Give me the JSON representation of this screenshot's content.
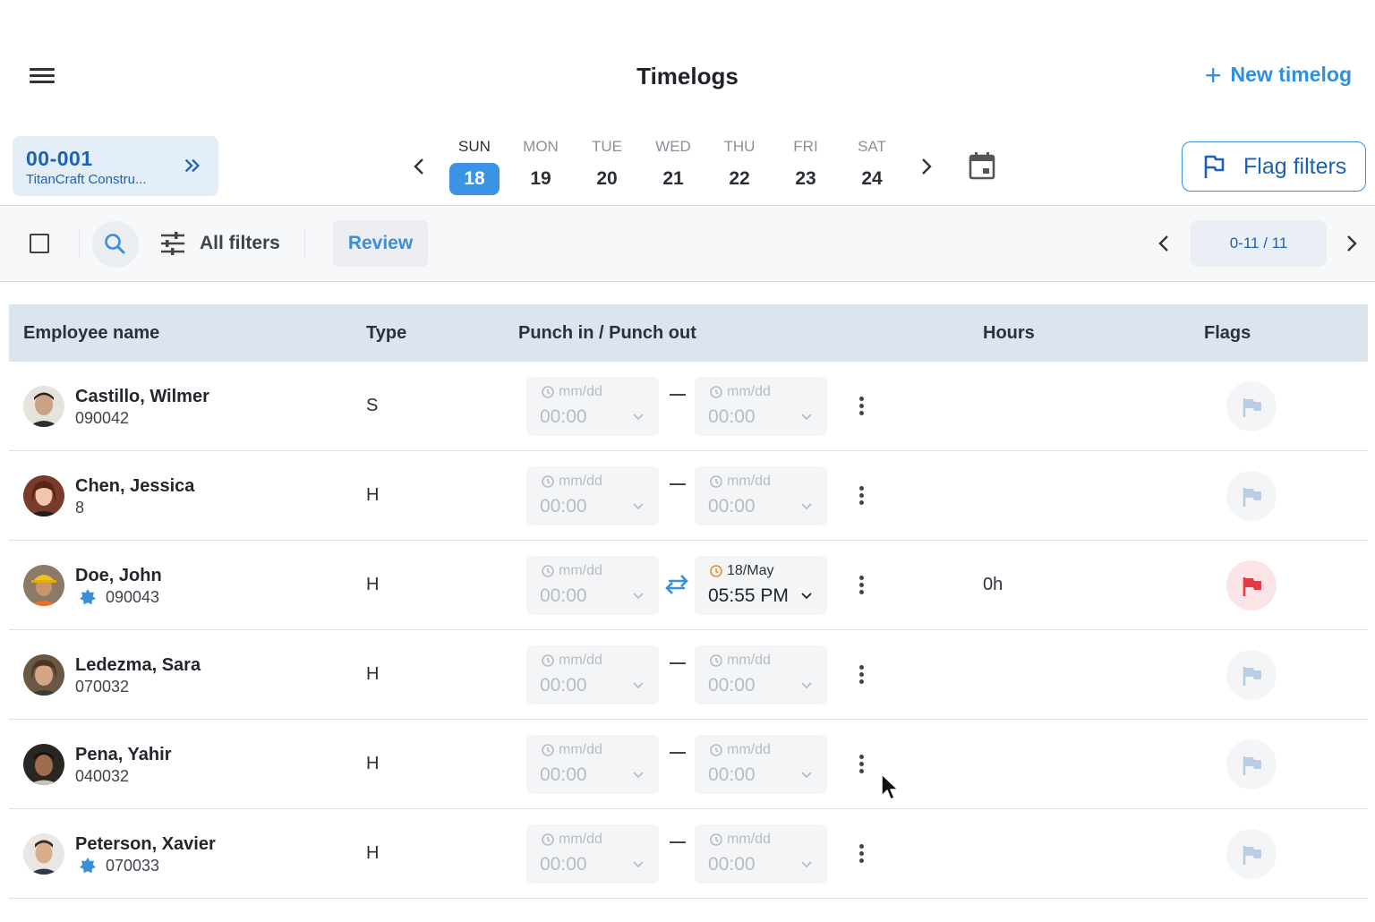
{
  "header": {
    "title": "Timelogs",
    "new_timelog_label": "New timelog"
  },
  "company": {
    "code": "00-001",
    "name": "TitanCraft Constru..."
  },
  "week": {
    "days": [
      {
        "name": "SUN",
        "date": "18",
        "active": true
      },
      {
        "name": "MON",
        "date": "19",
        "active": false
      },
      {
        "name": "TUE",
        "date": "20",
        "active": false
      },
      {
        "name": "WED",
        "date": "21",
        "active": false
      },
      {
        "name": "THU",
        "date": "22",
        "active": false
      },
      {
        "name": "FRI",
        "date": "23",
        "active": false
      },
      {
        "name": "SAT",
        "date": "24",
        "active": false
      }
    ]
  },
  "flag_filters_label": "Flag filters",
  "toolbar": {
    "all_filters_label": "All filters",
    "review_label": "Review",
    "pagination": "0-11 / 11"
  },
  "table": {
    "columns": [
      "Employee name",
      "Type",
      "Punch in / Punch out",
      "Hours",
      "Flags"
    ],
    "placeholder_date": "mm/dd",
    "placeholder_time": "00:00",
    "rows": [
      {
        "name": "Castillo, Wilmer",
        "id": "090042",
        "badge": false,
        "type": "S",
        "punch_out_date": "mm/dd",
        "punch_out_time": "00:00",
        "hours": "",
        "flagged": false
      },
      {
        "name": "Chen, Jessica",
        "id": "8",
        "badge": false,
        "type": "H",
        "punch_out_date": "mm/dd",
        "punch_out_time": "00:00",
        "hours": "",
        "flagged": false
      },
      {
        "name": "Doe, John",
        "id": "090043",
        "badge": true,
        "type": "H",
        "punch_out_date": "18/May",
        "punch_out_time": "05:55 PM",
        "hours": "0h",
        "flagged": true
      },
      {
        "name": "Ledezma, Sara",
        "id": "070032",
        "badge": false,
        "type": "H",
        "punch_out_date": "mm/dd",
        "punch_out_time": "00:00",
        "hours": "",
        "flagged": false
      },
      {
        "name": "Pena, Yahir",
        "id": "040032",
        "badge": false,
        "type": "H",
        "punch_out_date": "mm/dd",
        "punch_out_time": "00:00",
        "hours": "",
        "flagged": false
      },
      {
        "name": "Peterson, Xavier",
        "id": "070033",
        "badge": true,
        "type": "H",
        "punch_out_date": "mm/dd",
        "punch_out_time": "00:00",
        "hours": "",
        "flagged": false
      }
    ]
  },
  "colors": {
    "accent": "#3b93e3",
    "brand_dark": "#1b62b4",
    "header_bg": "#dce5ef",
    "flag_red": "#e53945",
    "flag_idle": "#b9cde3",
    "punch_out_icon": "#f08a24"
  },
  "icons": {
    "menu": "menu-icon",
    "plus": "plus-icon",
    "double_chevron": "double-chevron-right-icon",
    "calendar": "calendar-icon",
    "flag": "flag-icon",
    "search": "search-icon",
    "filters": "tune-icon",
    "badge": "star-badge-icon",
    "swap": "swap-arrows-icon",
    "more": "more-vertical-icon"
  }
}
